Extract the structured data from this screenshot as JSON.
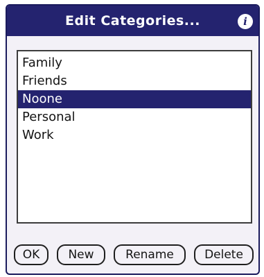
{
  "dialog": {
    "title": "Edit Categories...",
    "info_icon": "info-icon"
  },
  "categories": {
    "items": [
      {
        "label": "Family",
        "selected": false
      },
      {
        "label": "Friends",
        "selected": false
      },
      {
        "label": "Noone",
        "selected": true
      },
      {
        "label": "Personal",
        "selected": false
      },
      {
        "label": "Work",
        "selected": false
      }
    ]
  },
  "buttons": {
    "ok": "OK",
    "new": "New",
    "rename": "Rename",
    "delete": "Delete"
  },
  "colors": {
    "accent": "#24236f",
    "background": "#f3f1f7",
    "list_background": "#ffffff"
  }
}
